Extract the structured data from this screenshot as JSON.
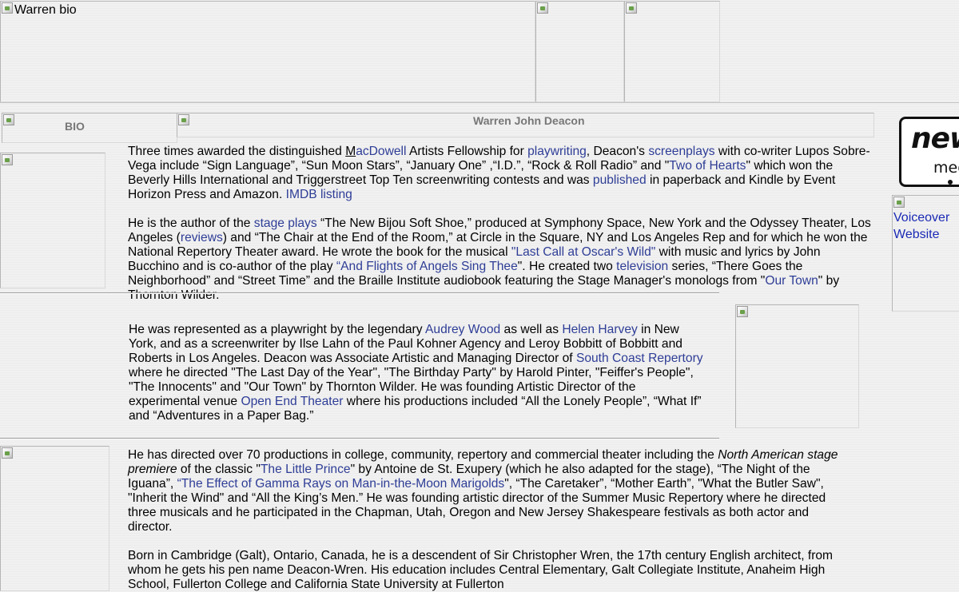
{
  "header": {
    "banner_alt": "Warren bio",
    "bio_alt": "BIO",
    "name_title": "Warren John Deacon"
  },
  "sidebar": {
    "logo_line1": "new",
    "logo_line2": "med",
    "voiceover_label": "Voiceover Website"
  },
  "section1": {
    "p1": {
      "t1": "Three times awarded the distinguished ",
      "macdowell_m": "M",
      "macdowell_rest": "acDowell",
      "t2": " Artists Fellowship for ",
      "playwriting": "playwriting",
      "t3": ", Deacon's ",
      "screenplays": "screenplays",
      "t4": " with co-writer Lupos Sobre-Vega include “Sign Language”, “Sun Moon Stars”, “January One” ,“I.D.”, “Rock & Roll Radio” and \"",
      "two_of_hearts": "Two of Hearts",
      "t5": "\" which won the Beverly Hills International and Triggerstreet Top Ten screenwriting contests and was ",
      "published": "published",
      "t6": " in paperback and Kindle by Event Horizon Press and Amazon. ",
      "imdb": "IMDB listing"
    },
    "p2": {
      "t1": "He is the author of the ",
      "stage_plays": "stage plays",
      "t2": " “The New Bijou Soft Shoe,” produced at Symphony Space, New York and the Odyssey Theater, Los Angeles (",
      "reviews": "reviews",
      "t3": ") and “The Chair at the End of the Room,” at Circle in the Square, NY and Los Angeles Rep and for which he won the National Repertory Theater award. He wrote the book for the musical  ",
      "last_call": "\"Last Call at Oscar's Wild\"",
      "t4": " with music and lyrics by John Bucchino and is co-author of the play ",
      "angels": "“And Flights of Angels Sing Thee",
      "t5": "\".  He created two ",
      "television": "television",
      "t6": " series, “There Goes the Neighborhood” and “Street Time” and the Braille Institute audiobook featuring the Stage Manager's monologs from \"",
      "our_town": "Our Town",
      "t7": "\" by Thornton Wilder."
    }
  },
  "section2": {
    "t1": "He was represented as a playwright by the legendary ",
    "audrey": "Audrey Wood",
    "t2": " as well as ",
    "helen": "Helen Harvey",
    "t3": " in New York, and as a screenwriter by Ilse Lahn of the Paul Kohner Agency and Leroy Bobbitt of Bobbitt and Roberts in Los Angeles. Deacon was Associate Artistic and Managing Director of ",
    "south_coast": "South Coast Repertory",
    "t4": " where he directed  \"The Last Day of the Year\", \"The Birthday Party\" by Harold Pinter, \"Feiffer's People\", \"The Innocents\" and \"Our Town\" by Thornton Wilder.  He was founding Artistic Director of the experimental venue ",
    "open_end": "Open End Theater",
    "t5": " where his productions included “All the Lonely People”, “What If” and “Adventures in a Paper Bag.”"
  },
  "section3": {
    "p1": {
      "t1": "He has directed over 70 productions in college, community, repertory and commercial theater including the ",
      "premiere": "North American stage premiere",
      "t2": " of the classic \"",
      "little_prince": "The Little Prince",
      "t3": "\" by Antoine de St. Exupery (which he also adapted for the stage), “The Night of the Iguana”, ",
      "gamma": "“The Effect of Gamma Rays on Man-in-the-Moon Marigolds",
      "t4": "\", “The Caretaker”, “Mother Earth”, \"What the Butler Saw\", \"Inherit the Wind\" and “All the King’s Men.”  He was founding artistic director of the Summer Music Repertory where he directed three musicals and he participated in the Chapman, Utah, Oregon and New Jersey Shakespeare festivals as both actor and director."
    },
    "p2": "Born in Cambridge (Galt), Ontario, Canada, he is a descendent of Sir Christopher Wren, the 17th century English architect, from whom he gets his pen name Deacon-Wren. His education includes Central Elementary, Galt Collegiate Institute, Anaheim High School, Fullerton College and California State University at Fullerton"
  }
}
